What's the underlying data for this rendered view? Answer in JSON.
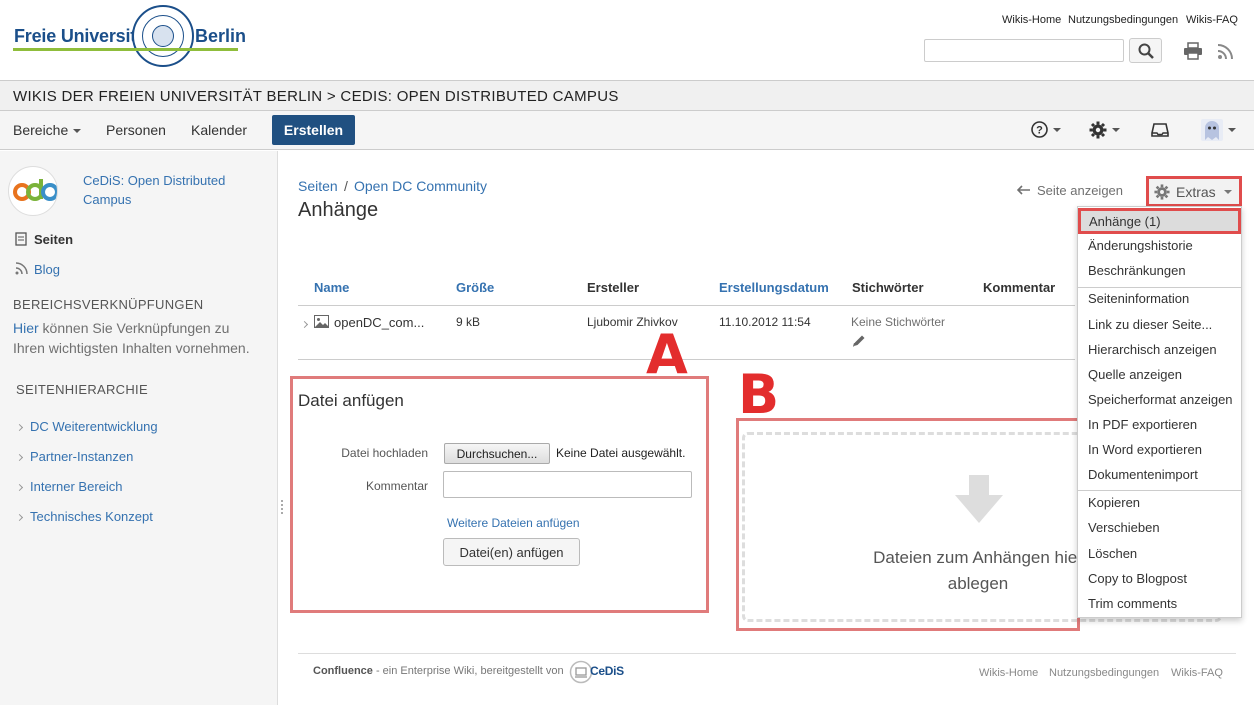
{
  "header": {
    "logo_left": "Freie Universität",
    "logo_right": "Berlin",
    "links": [
      "Wikis-Home",
      "Nutzungsbedingungen",
      "Wikis-FAQ"
    ],
    "search_value": ""
  },
  "breadcrumb_band": "WIKIS DER FREIEN UNIVERSITÄT BERLIN > CEDIS: OPEN DISTRIBUTED CAMPUS",
  "nav": {
    "spaces": "Bereiche",
    "people": "Personen",
    "calendar": "Kalender",
    "create": "Erstellen"
  },
  "sidebar": {
    "space_name": "CeDiS: Open Distributed Campus",
    "pages": "Seiten",
    "blog": "Blog",
    "links_heading": "BEREICHSVERKNÜPFUNGEN",
    "links_here": "Hier",
    "links_text": " können Sie Verknüpfungen zu Ihren wichtigsten Inhalten vornehmen.",
    "hierarchy_heading": "SEITENHIERARCHIE",
    "tree": [
      "DC Weiterentwicklung",
      "Partner-Instanzen",
      "Interner Bereich",
      "Technisches Konzept"
    ]
  },
  "main": {
    "crumb1": "Seiten",
    "crumb_sep": "/",
    "crumb2": "Open DC Community",
    "title": "Anhänge",
    "view_page": "Seite anzeigen",
    "extras": "Extras"
  },
  "table": {
    "headers": [
      "Name",
      "Größe",
      "Ersteller",
      "Erstellungsdatum",
      "Stichwörter",
      "Kommentar"
    ],
    "row": {
      "name": "openDC_com...",
      "size": "9 kB",
      "creator": "Ljubomir Zhivkov",
      "date": "11.10.2012 11:54",
      "tags": "Keine Stichwörter"
    }
  },
  "upload": {
    "marker": "A",
    "title": "Datei anfügen",
    "file_label": "Datei hochladen",
    "browse": "Durchsuchen...",
    "no_file": "Keine Datei ausgewählt.",
    "comment_label": "Kommentar",
    "more_files": "Weitere Dateien anfügen",
    "attach_button": "Datei(en) anfügen"
  },
  "dropzone": {
    "marker": "B",
    "line1": "Dateien zum Anhängen hier",
    "line2": "ablegen"
  },
  "extras_menu": {
    "group1": [
      "Anhänge (1)",
      "Änderungshistorie",
      "Beschränkungen"
    ],
    "group2": [
      "Seiteninformation",
      "Link zu dieser Seite...",
      "Hierarchisch anzeigen",
      "Quelle anzeigen",
      "Speicherformat anzeigen",
      "In PDF exportieren",
      "In Word exportieren",
      "Dokumentenimport"
    ],
    "group3": [
      "Kopieren",
      "Verschieben",
      "Löschen",
      "Copy to Blogpost",
      "Trim comments"
    ]
  },
  "footer": {
    "brand": "Confluence",
    "text": " - ein Enterprise Wiki, bereitgestellt von",
    "logo_text": "CeDiS",
    "links": [
      "Wikis-Home",
      "Nutzungsbedingungen",
      "Wikis-FAQ"
    ]
  },
  "colors": {
    "link": "#3572b0",
    "primary_button": "#205081",
    "annotation_red": "#e32d2d",
    "logo_green": "#8fbd3b"
  }
}
